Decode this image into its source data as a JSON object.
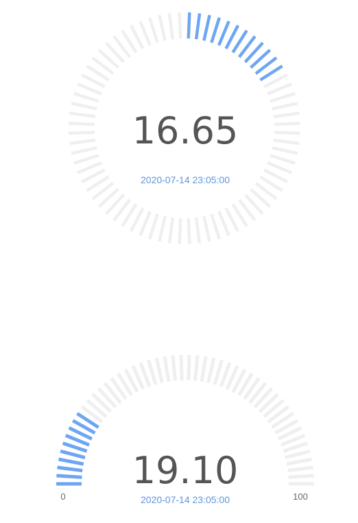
{
  "colors": {
    "accent": "#6ea6f2",
    "track": "#efefef",
    "value_text": "#555555",
    "time_text": "#5e95dc",
    "end_label_text": "#666666"
  },
  "chart_data": [
    {
      "type": "gauge",
      "shape": "full-ring",
      "value": 16.65,
      "display_value": "16.65",
      "min": 0,
      "max": 100,
      "timestamp": "2020-07-14 23:05:00"
    },
    {
      "type": "gauge",
      "shape": "semicircle",
      "value": 19.1,
      "display_value": "19.10",
      "min": 0,
      "max": 100,
      "min_label": "0",
      "max_label": "100",
      "timestamp": "2020-07-14 23:05:00"
    }
  ]
}
